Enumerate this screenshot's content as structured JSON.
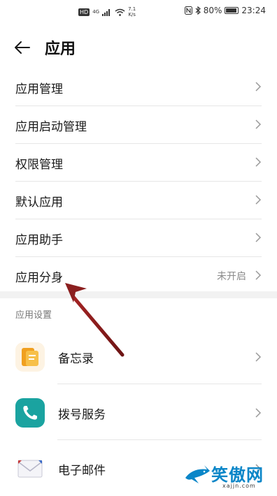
{
  "status_bar": {
    "hd": "HD",
    "network": "4G",
    "speed_value": "7.1",
    "speed_unit": "K/s",
    "battery": "80%",
    "time": "23:24"
  },
  "header": {
    "title": "应用"
  },
  "menu": {
    "items": [
      {
        "label": "应用管理",
        "value": ""
      },
      {
        "label": "应用启动管理",
        "value": ""
      },
      {
        "label": "权限管理",
        "value": ""
      },
      {
        "label": "默认应用",
        "value": ""
      },
      {
        "label": "应用助手",
        "value": ""
      },
      {
        "label": "应用分身",
        "value": "未开启"
      }
    ]
  },
  "settings": {
    "section_title": "应用设置",
    "apps": [
      {
        "label": "备忘录",
        "icon": "memo-icon"
      },
      {
        "label": "拨号服务",
        "icon": "phone-icon"
      },
      {
        "label": "电子邮件",
        "icon": "mail-icon"
      }
    ]
  },
  "watermark": {
    "brand": "笑傲网",
    "url": "xajjn.com"
  },
  "colors": {
    "accent_arrow": "#8b1f1f",
    "memo_icon": "#f0a020",
    "phone_icon": "#1aa3a0",
    "watermark": "#0a86c8"
  }
}
